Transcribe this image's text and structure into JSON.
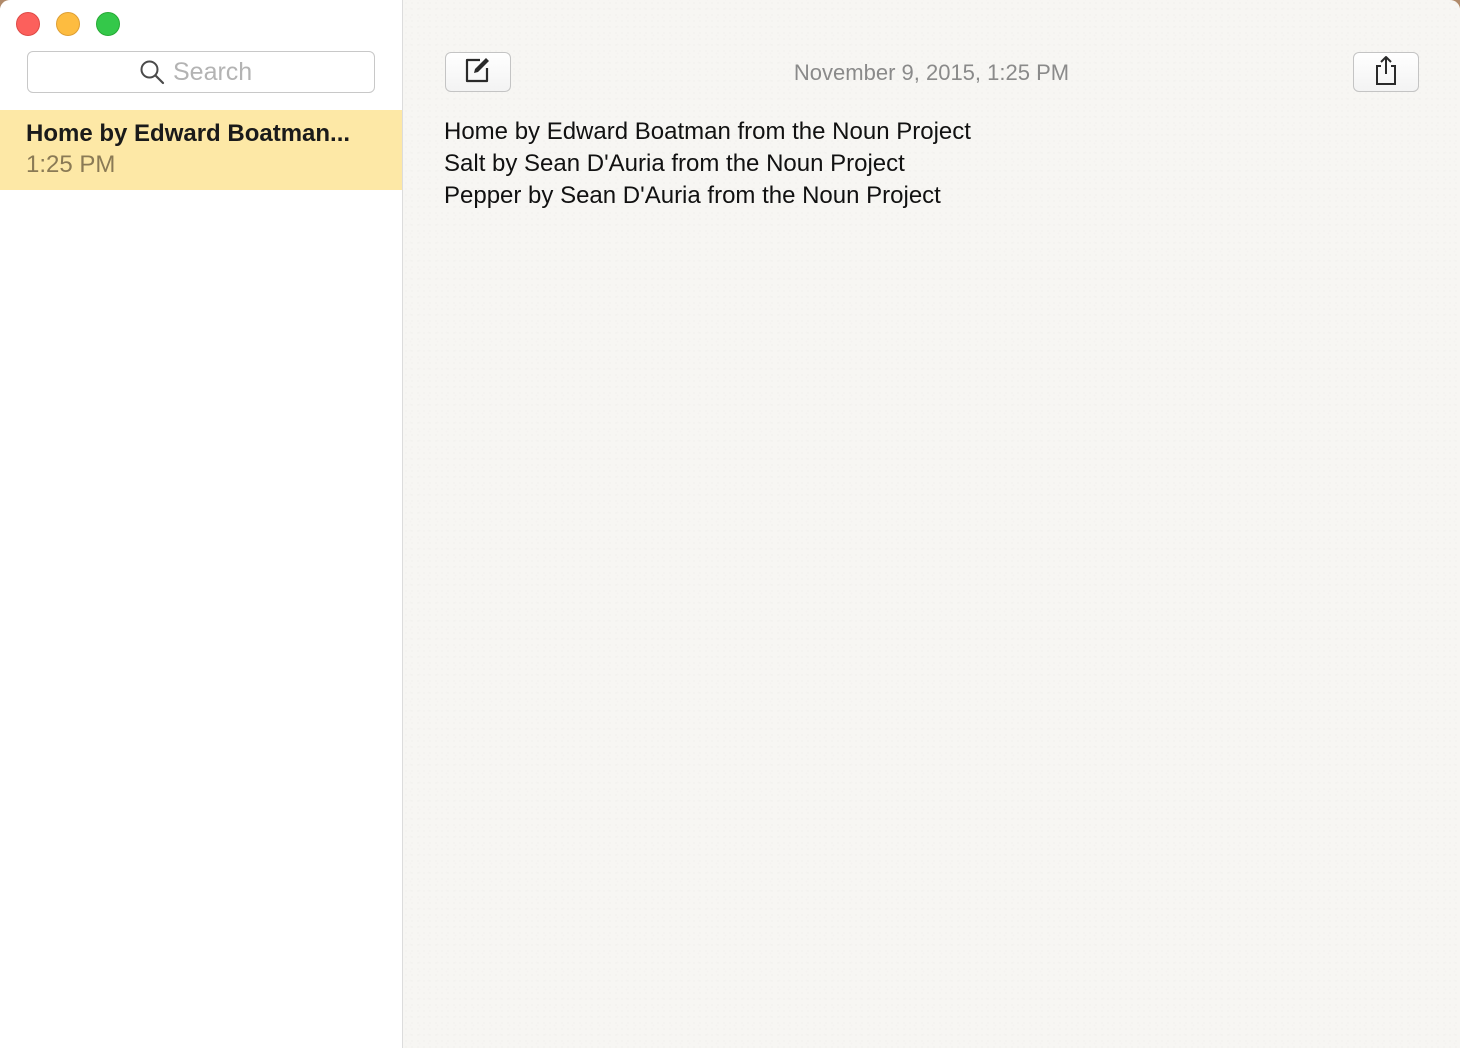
{
  "window": {
    "controls": [
      "close",
      "minimize",
      "zoom"
    ]
  },
  "sidebar": {
    "search": {
      "placeholder": "Search",
      "icon": "search-icon"
    },
    "notes": [
      {
        "title": "Home by Edward Boatman...",
        "time": "1:25 PM",
        "selected": true
      }
    ]
  },
  "toolbar": {
    "compose_icon": "compose-icon",
    "share_icon": "share-icon",
    "date": "November 9, 2015, 1:25 PM"
  },
  "note": {
    "lines": [
      "Home by Edward Boatman from the Noun Project",
      "Salt by Sean D'Auria from the Noun Project",
      "Pepper by Sean D'Auria from the Noun Project"
    ]
  },
  "colors": {
    "selected_note": "#fde8a6",
    "close": "#fc605c",
    "minimize": "#fdbc40",
    "zoom": "#34c84a"
  }
}
